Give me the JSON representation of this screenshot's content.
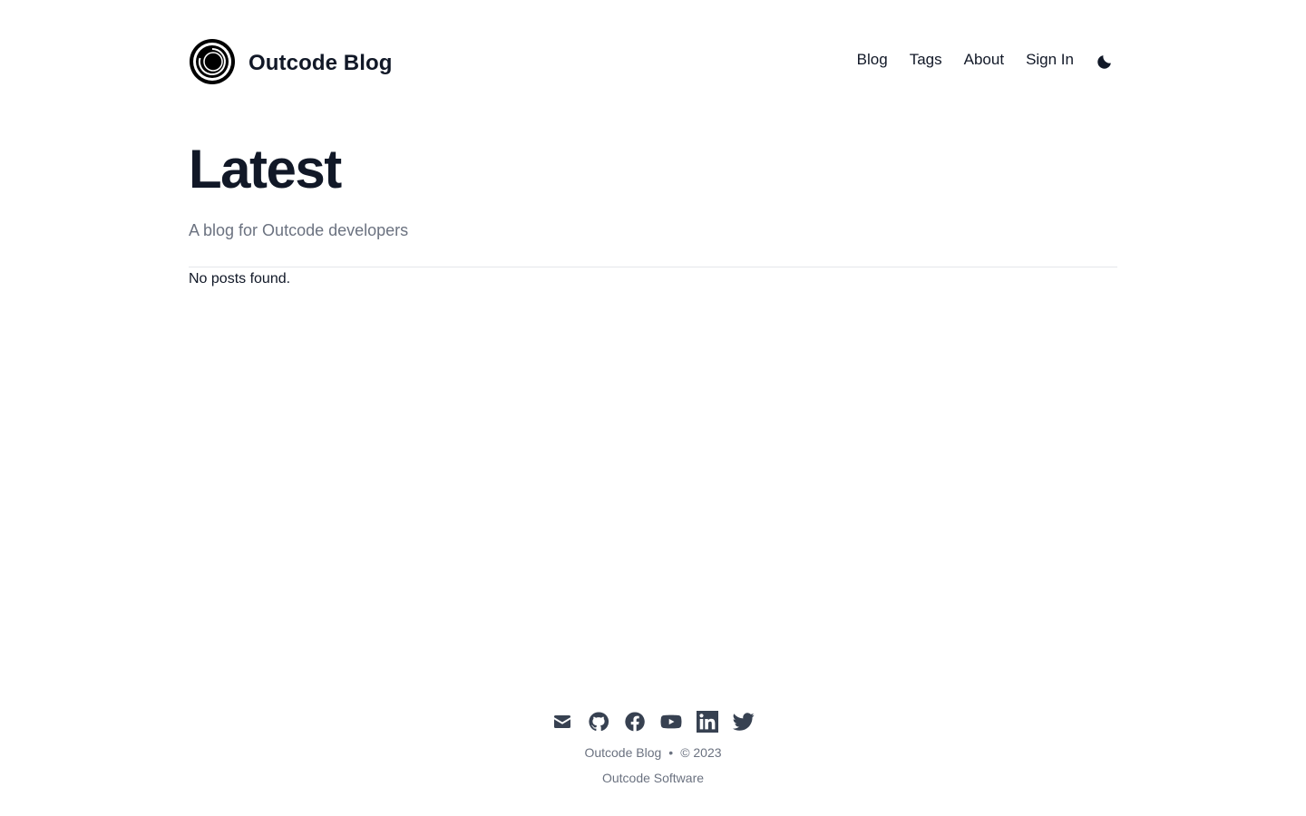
{
  "header": {
    "site_title": "Outcode Blog",
    "logo_icon": "concentric-circle-logo",
    "nav": [
      {
        "label": "Blog"
      },
      {
        "label": "Tags"
      },
      {
        "label": "About"
      },
      {
        "label": "Sign In"
      }
    ],
    "theme_toggle_icon": "moon-icon"
  },
  "main": {
    "title": "Latest",
    "subtitle": "A blog for Outcode developers",
    "empty_message": "No posts found."
  },
  "footer": {
    "social_icons": [
      "mail-icon",
      "github-icon",
      "facebook-icon",
      "youtube-icon",
      "linkedin-icon",
      "twitter-icon"
    ],
    "site_name": "Outcode Blog",
    "separator": "•",
    "copyright": "© 2023",
    "company": "Outcode Software"
  },
  "colors": {
    "text_primary": "#111827",
    "text_muted": "#6b7280",
    "icon": "#374151",
    "divider": "#e5e7eb"
  }
}
